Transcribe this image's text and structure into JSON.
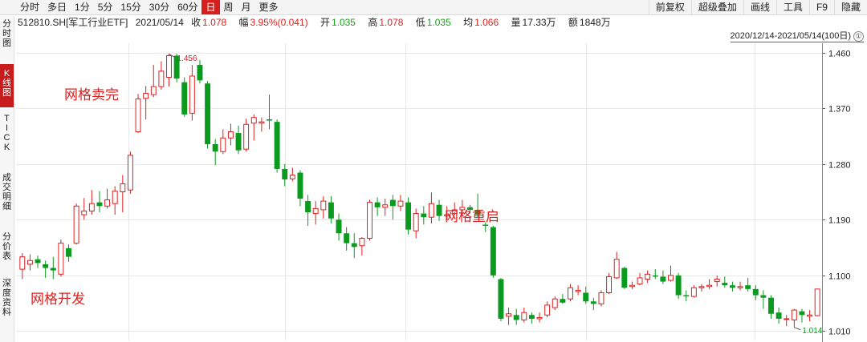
{
  "toolbar": {
    "periods": [
      "分时",
      "多日",
      "1分",
      "5分",
      "15分",
      "30分",
      "60分",
      "日",
      "周",
      "月",
      "更多"
    ],
    "active_period": "日",
    "tools": [
      "前复权",
      "超级叠加",
      "画线",
      "工具",
      "F9",
      "隐藏"
    ]
  },
  "side_tabs": [
    "分\n时\n图",
    "K\n线\n图",
    "T\nI\nC\nK",
    "成\n交\n明\n细",
    "分\n价\n表",
    "深\n度\n资\n料"
  ],
  "active_side_tab": "K\n线\n图",
  "info": {
    "code": "512810.SH[军工行业ETF]",
    "date": "2021/05/14",
    "close_label": "收",
    "close": "1.078",
    "change_label": "幅",
    "change": "3.95%(0.041)",
    "open_label": "开",
    "open": "1.035",
    "high_label": "高",
    "high": "1.078",
    "low_label": "低",
    "low": "1.035",
    "avg_label": "均",
    "avg": "1.066",
    "volume_label": "量",
    "volume": "17.33万",
    "amount_label": "额",
    "amount": "1848万"
  },
  "range": {
    "text": "2020/12/14-2021/05/14(100日)",
    "badge": "①"
  },
  "annotations": {
    "grid_sold": "网格卖完",
    "grid_start": "网格开发",
    "grid_restart": "网格重启"
  },
  "colors": {
    "up": "#e02020",
    "down": "#0a9a1e",
    "grid": "#e8e8e8"
  },
  "chart_data": {
    "type": "candlestick",
    "y_ticks": [
      "1.460",
      "1.370",
      "1.280",
      "1.190",
      "1.100",
      "1.010"
    ],
    "ylim": [
      0.995,
      1.475
    ],
    "max_label": "1.456",
    "min_label": "1.014",
    "candles": [
      [
        1.11,
        1.13,
        1.136,
        1.094
      ],
      [
        1.118,
        1.124,
        1.134,
        1.108
      ],
      [
        1.126,
        1.12,
        1.132,
        1.112
      ],
      [
        1.118,
        1.112,
        1.124,
        1.096
      ],
      [
        1.112,
        1.108,
        1.13,
        1.094
      ],
      [
        1.102,
        1.152,
        1.158,
        1.098
      ],
      [
        1.144,
        1.13,
        1.15,
        1.122
      ],
      [
        1.152,
        1.212,
        1.216,
        1.15
      ],
      [
        1.198,
        1.204,
        1.225,
        1.19
      ],
      [
        1.204,
        1.216,
        1.238,
        1.198
      ],
      [
        1.218,
        1.212,
        1.236,
        1.202
      ],
      [
        1.212,
        1.222,
        1.24,
        1.208
      ],
      [
        1.216,
        1.236,
        1.244,
        1.198
      ],
      [
        1.235,
        1.248,
        1.262,
        1.202
      ],
      [
        1.238,
        1.294,
        1.3,
        1.232
      ],
      [
        1.332,
        1.385,
        1.393,
        1.33
      ],
      [
        1.386,
        1.394,
        1.406,
        1.352
      ],
      [
        1.392,
        1.405,
        1.44,
        1.388
      ],
      [
        1.405,
        1.43,
        1.446,
        1.4
      ],
      [
        1.42,
        1.455,
        1.458,
        1.405
      ],
      [
        1.455,
        1.418,
        1.458,
        1.412
      ],
      [
        1.412,
        1.36,
        1.42,
        1.356
      ],
      [
        1.362,
        1.422,
        1.44,
        1.35
      ],
      [
        1.44,
        1.415,
        1.448,
        1.41
      ],
      [
        1.41,
        1.312,
        1.414,
        1.305
      ],
      [
        1.312,
        1.3,
        1.32,
        1.278
      ],
      [
        1.3,
        1.322,
        1.336,
        1.296
      ],
      [
        1.322,
        1.332,
        1.345,
        1.31
      ],
      [
        1.33,
        1.302,
        1.342,
        1.296
      ],
      [
        1.304,
        1.344,
        1.353,
        1.3
      ],
      [
        1.346,
        1.355,
        1.36,
        1.318
      ],
      [
        1.346,
        1.348,
        1.355,
        1.332
      ],
      [
        1.352,
        1.35,
        1.392,
        1.336
      ],
      [
        1.348,
        1.272,
        1.352,
        1.266
      ],
      [
        1.272,
        1.255,
        1.28,
        1.244
      ],
      [
        1.256,
        1.262,
        1.274,
        1.252
      ],
      [
        1.266,
        1.224,
        1.27,
        1.212
      ],
      [
        1.22,
        1.202,
        1.23,
        1.18
      ],
      [
        1.2,
        1.208,
        1.22,
        1.182
      ],
      [
        1.206,
        1.22,
        1.228,
        1.192
      ],
      [
        1.218,
        1.192,
        1.228,
        1.184
      ],
      [
        1.19,
        1.168,
        1.2,
        1.156
      ],
      [
        1.168,
        1.152,
        1.178,
        1.14
      ],
      [
        1.152,
        1.146,
        1.168,
        1.128
      ],
      [
        1.148,
        1.16,
        1.162,
        1.132
      ],
      [
        1.16,
        1.218,
        1.222,
        1.156
      ],
      [
        1.218,
        1.21,
        1.226,
        1.196
      ],
      [
        1.21,
        1.214,
        1.224,
        1.196
      ],
      [
        1.222,
        1.212,
        1.23,
        1.19
      ],
      [
        1.212,
        1.22,
        1.23,
        1.204
      ],
      [
        1.218,
        1.174,
        1.226,
        1.166
      ],
      [
        1.172,
        1.2,
        1.208,
        1.16
      ],
      [
        1.2,
        1.194,
        1.212,
        1.182
      ],
      [
        1.194,
        1.216,
        1.234,
        1.184
      ],
      [
        1.214,
        1.196,
        1.222,
        1.188
      ],
      [
        1.196,
        1.198,
        1.212,
        1.19
      ],
      [
        1.2,
        1.206,
        1.218,
        1.198
      ],
      [
        1.206,
        1.21,
        1.222,
        1.196
      ],
      [
        1.21,
        1.206,
        1.214,
        1.2
      ],
      [
        1.206,
        1.198,
        1.232,
        1.194
      ],
      [
        1.182,
        1.18,
        1.186,
        1.17
      ],
      [
        1.178,
        1.1,
        1.18,
        1.096
      ],
      [
        1.094,
        1.03,
        1.096,
        1.026
      ],
      [
        1.034,
        1.038,
        1.048,
        1.02
      ],
      [
        1.036,
        1.028,
        1.046,
        1.02
      ],
      [
        1.028,
        1.04,
        1.048,
        1.024
      ],
      [
        1.036,
        1.03,
        1.04,
        1.022
      ],
      [
        1.03,
        1.032,
        1.04,
        1.024
      ],
      [
        1.036,
        1.052,
        1.058,
        1.032
      ],
      [
        1.048,
        1.062,
        1.066,
        1.044
      ],
      [
        1.062,
        1.056,
        1.07,
        1.054
      ],
      [
        1.062,
        1.08,
        1.086,
        1.058
      ],
      [
        1.074,
        1.076,
        1.084,
        1.068
      ],
      [
        1.072,
        1.058,
        1.082,
        1.054
      ],
      [
        1.058,
        1.054,
        1.064,
        1.044
      ],
      [
        1.054,
        1.072,
        1.076,
        1.05
      ],
      [
        1.072,
        1.098,
        1.104,
        1.07
      ],
      [
        1.096,
        1.126,
        1.138,
        1.094
      ],
      [
        1.112,
        1.08,
        1.114,
        1.078
      ],
      [
        1.082,
        1.084,
        1.09,
        1.078
      ],
      [
        1.086,
        1.096,
        1.104,
        1.084
      ],
      [
        1.094,
        1.102,
        1.108,
        1.088
      ],
      [
        1.1,
        1.098,
        1.11,
        1.094
      ],
      [
        1.098,
        1.09,
        1.108,
        1.086
      ],
      [
        1.092,
        1.1,
        1.116,
        1.09
      ],
      [
        1.1,
        1.068,
        1.104,
        1.062
      ],
      [
        1.068,
        1.066,
        1.076,
        1.058
      ],
      [
        1.066,
        1.08,
        1.084,
        1.064
      ],
      [
        1.08,
        1.082,
        1.086,
        1.074
      ],
      [
        1.082,
        1.084,
        1.094,
        1.078
      ],
      [
        1.09,
        1.094,
        1.1,
        1.082
      ],
      [
        1.088,
        1.084,
        1.098,
        1.08
      ],
      [
        1.084,
        1.08,
        1.09,
        1.074
      ],
      [
        1.08,
        1.082,
        1.09,
        1.076
      ],
      [
        1.084,
        1.078,
        1.096,
        1.074
      ],
      [
        1.078,
        1.068,
        1.084,
        1.06
      ],
      [
        1.068,
        1.064,
        1.076,
        1.046
      ],
      [
        1.064,
        1.038,
        1.068,
        1.03
      ],
      [
        1.04,
        1.03,
        1.048,
        1.022
      ],
      [
        1.03,
        1.03,
        1.036,
        1.018
      ],
      [
        1.028,
        1.044,
        1.046,
        1.016
      ],
      [
        1.042,
        1.036,
        1.046,
        1.024
      ],
      [
        1.034,
        1.036,
        1.044,
        1.026
      ],
      [
        1.035,
        1.078,
        1.078,
        1.035
      ]
    ]
  }
}
